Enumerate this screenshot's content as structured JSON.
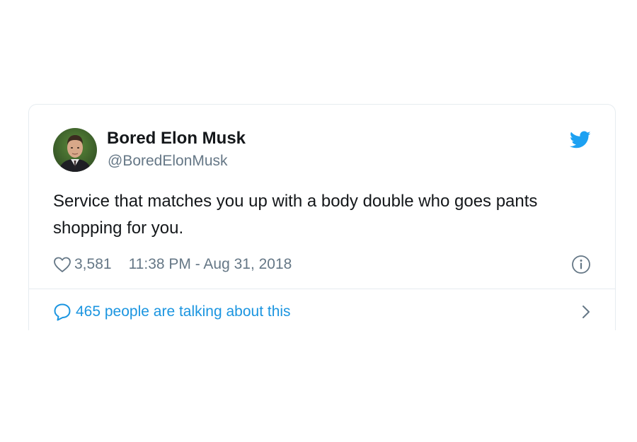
{
  "tweet": {
    "author": {
      "display_name": "Bored Elon Musk",
      "handle": "@BoredElonMusk"
    },
    "text": "Service that matches you up with a body double who goes pants shopping for you.",
    "likes": "3,581",
    "timestamp": "11:38 PM - Aug 31, 2018",
    "conversation_label": "465 people are talking about this"
  },
  "icons": {
    "brand": "twitter-bird-icon",
    "like": "heart-icon",
    "info": "info-icon",
    "conversation": "speech-bubble-icon",
    "more": "chevron-right-icon"
  },
  "colors": {
    "brand": "#1da1f2",
    "link": "#1b95e0",
    "secondary_text": "#657786",
    "primary_text": "#14171a",
    "border": "#e6ecf0"
  }
}
